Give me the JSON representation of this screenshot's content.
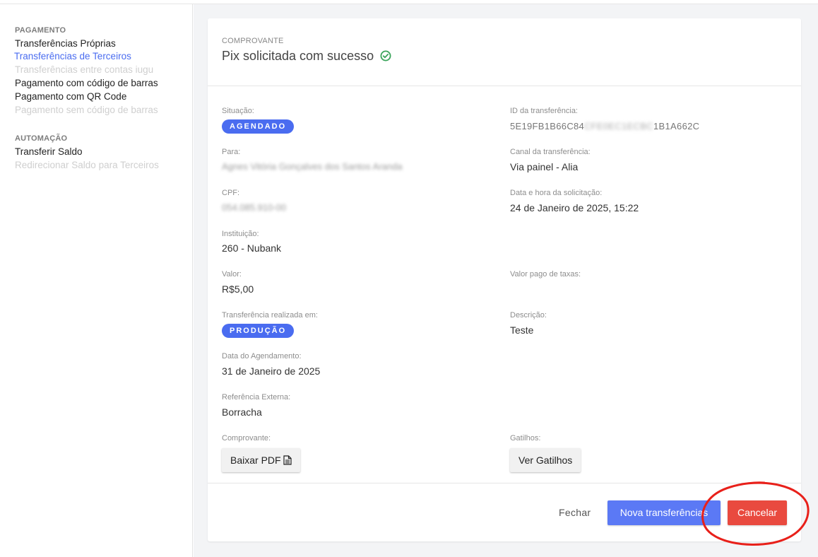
{
  "sidebar": {
    "sections": [
      {
        "title": "PAGAMENTO",
        "items": [
          {
            "label": "Transferências Próprias",
            "state": "normal"
          },
          {
            "label": "Transferências de Terceiros",
            "state": "active"
          },
          {
            "label": "Transferências entre contas iugu",
            "state": "disabled"
          },
          {
            "label": "Pagamento com código de barras",
            "state": "normal"
          },
          {
            "label": "Pagamento com QR Code",
            "state": "normal"
          },
          {
            "label": "Pagamento sem código de barras",
            "state": "disabled"
          }
        ]
      },
      {
        "title": "AUTOMAÇÃO",
        "items": [
          {
            "label": "Transferir Saldo",
            "state": "normal"
          },
          {
            "label": "Redirecionar Saldo para Terceiros",
            "state": "disabled"
          }
        ]
      }
    ]
  },
  "receipt": {
    "eyebrow": "COMPROVANTE",
    "title": "Pix solicitada com sucesso",
    "status_icon": "check-circle-icon",
    "left": {
      "situacao": {
        "label": "Situação:",
        "badge": "AGENDADO"
      },
      "para": {
        "label": "Para:",
        "value": "Agnes Vitória Gonçalves dos Santos Aranda"
      },
      "cpf": {
        "label": "CPF:",
        "value": "054.085.910-00"
      },
      "instituicao": {
        "label": "Instituição:",
        "value": "260 - Nubank"
      },
      "valor": {
        "label": "Valor:",
        "value": "R$5,00"
      },
      "ambiente": {
        "label": "Transferência realizada em:",
        "badge": "PRODUÇÃO"
      },
      "agendamento": {
        "label": "Data do Agendamento:",
        "value": "31 de Janeiro de 2025"
      },
      "referencia": {
        "label": "Referência Externa:",
        "value": "Borracha"
      },
      "comprovante": {
        "label": "Comprovante:",
        "button": "Baixar PDF"
      }
    },
    "right": {
      "id": {
        "label": "ID da transferência:",
        "prefix": "5E19FB1B66C84",
        "hidden": "CFE0EC1ECBC",
        "suffix": "1B1A662C"
      },
      "canal": {
        "label": "Canal da transferência:",
        "value": "Via painel - Alia"
      },
      "data_hora": {
        "label": "Data e hora da solicitação:",
        "value": "24 de Janeiro de 2025, 15:22"
      },
      "taxas": {
        "label": "Valor pago de taxas:"
      },
      "descricao": {
        "label": "Descrição:",
        "value": "Teste"
      },
      "gatilhos": {
        "label": "Gatilhos:",
        "button": "Ver Gatilhos"
      }
    },
    "footer": {
      "close": "Fechar",
      "new": "Nova transferências",
      "cancel": "Cancelar"
    }
  },
  "colors": {
    "accent": "#4a6cf0",
    "primary_button": "#5b79f5",
    "danger": "#e94a3f",
    "success": "#3aa45a",
    "annotation": "#e8201a"
  }
}
